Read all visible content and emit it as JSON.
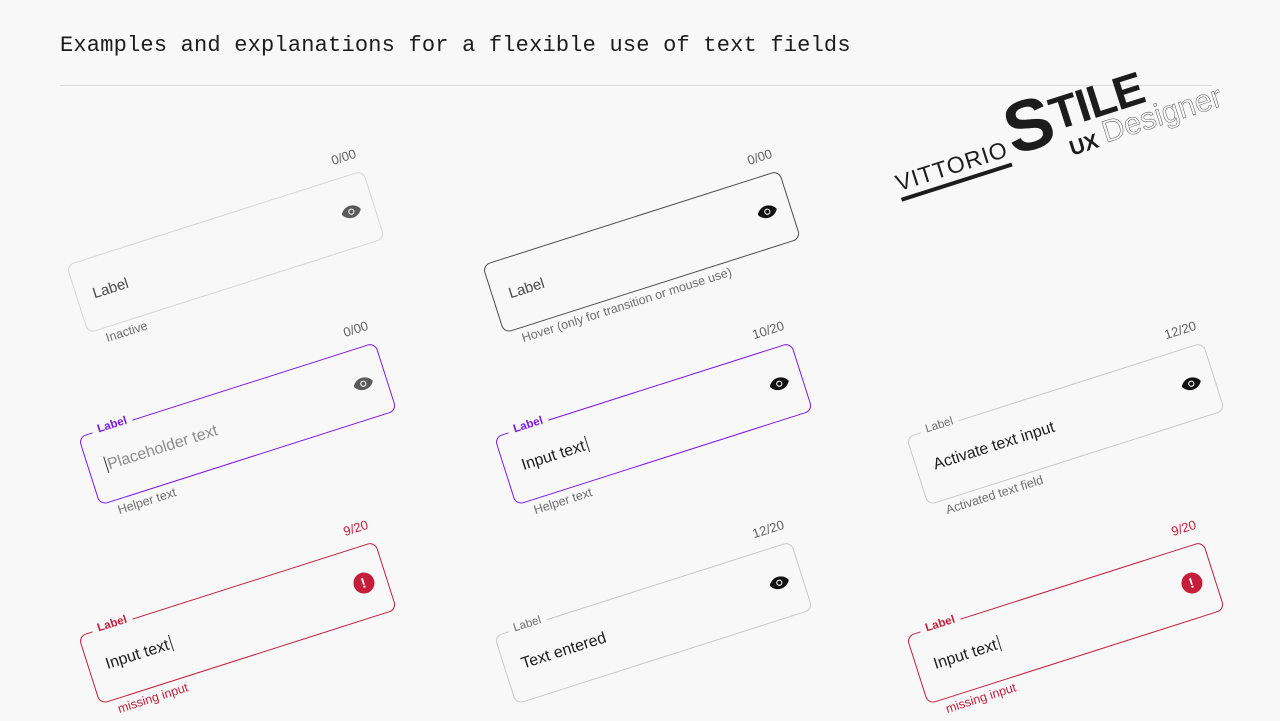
{
  "page": {
    "title": "Examples and explanations for a flexible use of text fields",
    "background_color": "#f8f8f8"
  },
  "colors": {
    "accent_focus": "#7c18e8",
    "error": "#c41e3a",
    "border_inactive": "#d6d6d6",
    "border_hover": "#4d4d4d",
    "text_primary": "#1c1c1c",
    "text_helper": "#6e6e6e",
    "placeholder": "#8c8c8c"
  },
  "logo": {
    "brand_first": "VITTORIO",
    "brand_s": "S",
    "brand_rest": "TILE",
    "role_ux": "UX",
    "role_designer": "Designer"
  },
  "fields": [
    {
      "state": "inactive",
      "state_name": "inactive",
      "label": "Label",
      "value": "",
      "placeholder": "",
      "helper": "Inactive",
      "counter": "0/00",
      "icon": "eye-icon",
      "label_floating": false,
      "has_caret": false
    },
    {
      "state": "hover",
      "state_name": "hover",
      "label": "Label",
      "value": "",
      "placeholder": "",
      "helper": "Hover (only for transition or mouse use)",
      "counter": "0/00",
      "icon": "eye-icon",
      "label_floating": false,
      "has_caret": false
    },
    {
      "state": "focus",
      "state_name": "focus-placeholder",
      "label": "Label",
      "value": "",
      "placeholder": "Placeholder text",
      "helper": "Helper text",
      "counter": "0/00",
      "icon": "eye-icon",
      "label_floating": true,
      "has_caret": true
    },
    {
      "state": "focus",
      "state_name": "focus-filled",
      "label": "Label",
      "value": "Input text",
      "placeholder": "",
      "helper": "Helper text",
      "counter": "10/20",
      "icon": "eye-icon",
      "label_floating": true,
      "has_caret": true
    },
    {
      "state": "active",
      "state_name": "activated",
      "label": "Label",
      "value": "Activate text input",
      "placeholder": "",
      "helper": "Activated text field",
      "counter": "12/20",
      "icon": "eye-icon",
      "label_floating": true,
      "has_caret": false
    },
    {
      "state": "error",
      "state_name": "error",
      "label": "Label",
      "value": "Input text",
      "placeholder": "",
      "helper": "missing input",
      "counter": "9/20",
      "icon": "error-icon",
      "label_floating": true,
      "has_caret": true
    },
    {
      "state": "active",
      "state_name": "text-entered",
      "label": "Label",
      "value": "Text entered",
      "placeholder": "",
      "helper": "",
      "counter": "12/20",
      "icon": "eye-icon",
      "label_floating": true,
      "has_caret": false
    },
    {
      "state": "error",
      "state_name": "error",
      "label": "Label",
      "value": "Input text",
      "placeholder": "",
      "helper": "missing input",
      "counter": "9/20",
      "icon": "error-icon",
      "label_floating": true,
      "has_caret": true
    }
  ],
  "error_icon_glyph": "!"
}
